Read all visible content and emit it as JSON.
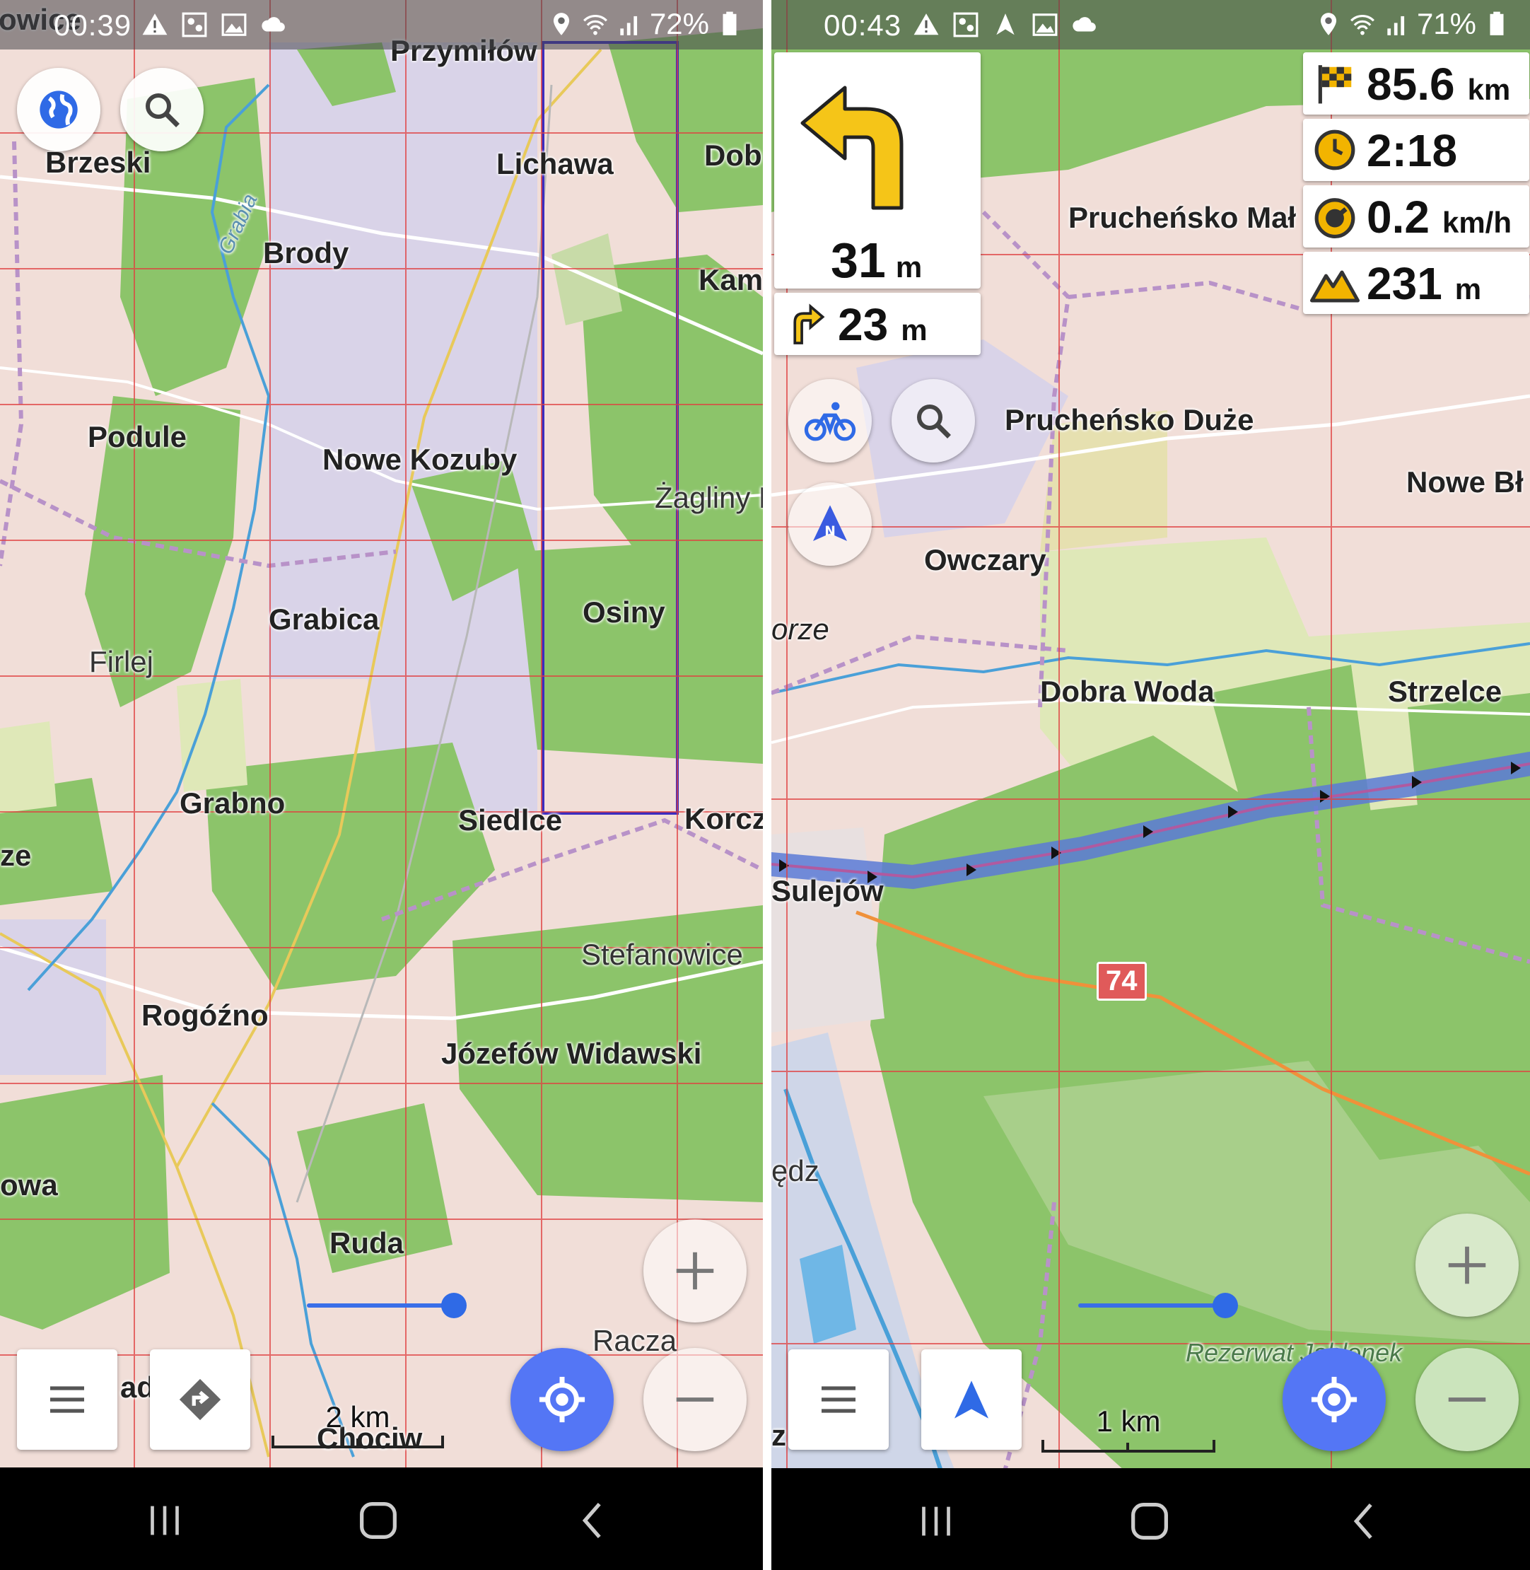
{
  "left": {
    "status": {
      "time": "00:39",
      "battery": "72%",
      "icons": [
        "warning-icon",
        "people-icon",
        "image-icon",
        "cloud-icon"
      ],
      "right_icons": [
        "location-icon",
        "wifi-icon",
        "signal-icon",
        "battery-icon"
      ]
    },
    "places": {
      "cut_top_left": "owice",
      "przymilow": "Przymiłów",
      "brzeski": "Brzeski",
      "lichawa": "Lichawa",
      "dob": "Dob",
      "brody": "Brody",
      "kam": "Kam",
      "podule": "Podule",
      "nowe_kozuby": "Nowe Kozuby",
      "zagliny": "Żagliny N",
      "grabica": "Grabica",
      "osiny": "Osiny",
      "firlej": "Firlej",
      "grabno": "Grabno",
      "siedlce": "Siedlce",
      "korcz": "Korcz",
      "ze": "ze",
      "stefanowice": "Stefanowice",
      "rogozno": "Rogóźno",
      "jozefow": "Józefów Widawski",
      "owa": "owa",
      "ruda": "Ruda",
      "racza": "Racza",
      "chociw": "Chociw",
      "ady": "ady",
      "grabia": "Grabia"
    },
    "scale_label": "2 km",
    "zoom_slider_value": 0.8
  },
  "right": {
    "status": {
      "time": "00:43",
      "battery": "71%",
      "icons": [
        "warning-icon",
        "people-icon",
        "navigation-icon",
        "image-icon",
        "cloud-icon"
      ],
      "right_icons": [
        "location-icon",
        "wifi-icon",
        "signal-icon",
        "battery-icon"
      ]
    },
    "turn": {
      "distance": "31",
      "unit": "m",
      "next_distance": "23",
      "next_unit": "m"
    },
    "info": [
      {
        "icon": "finish-flag-icon",
        "value": "85.6",
        "unit": "km"
      },
      {
        "icon": "clock-icon",
        "value": "2:18",
        "unit": ""
      },
      {
        "icon": "speedometer-icon",
        "value": "0.2",
        "unit": "km/h"
      },
      {
        "icon": "mountain-icon",
        "value": "231",
        "unit": "m"
      }
    ],
    "places": {
      "pruchensko_male": "Prucheńsko Mał",
      "pruchensko_duze": "Prucheńsko Duże",
      "nowe_bl": "Nowe Bł",
      "owczary": "Owczary",
      "orze": "orze",
      "dobra_woda": "Dobra Woda",
      "strzelce": "Strzelce",
      "sulejow": "Sulejów",
      "road_74": "74",
      "edz": "ędz",
      "rezerwat": "Rezerwat Jabłonek",
      "z": "z"
    },
    "scale_label": "1 km",
    "zoom_slider_value": 0.8
  },
  "colors": {
    "accent": "#5476f5",
    "grid": "#e03a3a",
    "forest": "#8cc46a",
    "residential": "#f1d9d3",
    "route": "#5b7ad6",
    "turn_arrow": "#f5c518"
  }
}
